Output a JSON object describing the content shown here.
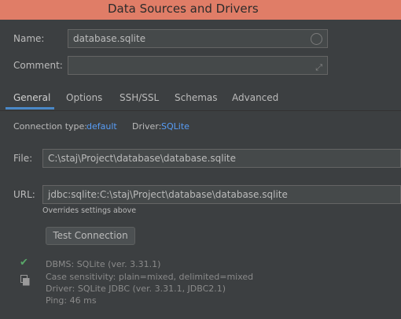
{
  "window": {
    "title": "Data Sources and Drivers"
  },
  "name": {
    "label": "Name:",
    "value": "database.sqlite"
  },
  "comment": {
    "label": "Comment:",
    "value": ""
  },
  "tabs": [
    {
      "label": "General",
      "active": true
    },
    {
      "label": "Options"
    },
    {
      "label": "SSH/SSL"
    },
    {
      "label": "Schemas"
    },
    {
      "label": "Advanced"
    }
  ],
  "connection": {
    "type_label": "Connection type:",
    "type_value": "default",
    "driver_label": "Driver:",
    "driver_value": "SQLite"
  },
  "file": {
    "label": "File:",
    "value": "C:\\staj\\Project\\database\\database.sqlite"
  },
  "url": {
    "label": "URL:",
    "value": "jdbc:sqlite:C:\\staj\\Project\\database\\database.sqlite",
    "hint": "Overrides settings above"
  },
  "test_button": "Test Connection",
  "info": [
    "DBMS: SQLite (ver. 3.31.1)",
    "Case sensitivity: plain=mixed, delimited=mixed",
    "Driver: SQLite JDBC (ver. 3.31.1, JDBC2.1)",
    "Ping: 46 ms"
  ],
  "colors": {
    "titlebar": "#e07d67",
    "accent": "#4a88c7",
    "link": "#589df6",
    "success": "#59a869"
  },
  "icons": {
    "status": "check-icon",
    "copy": "copy-icon",
    "name_field": "circle-icon",
    "comment_field": "expand-icon"
  }
}
